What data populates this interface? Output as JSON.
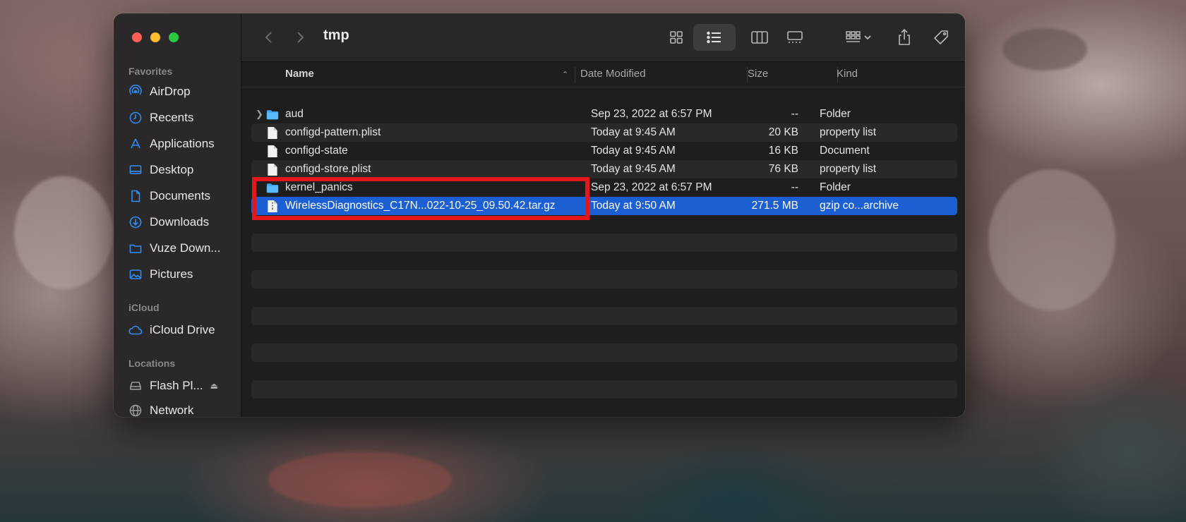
{
  "window": {
    "title": "tmp"
  },
  "sidebar": {
    "sections": {
      "favorites": "Favorites",
      "icloud": "iCloud",
      "locations": "Locations"
    },
    "favorites": [
      {
        "label": "AirDrop",
        "icon": "airdrop-icon"
      },
      {
        "label": "Recents",
        "icon": "clock-icon"
      },
      {
        "label": "Applications",
        "icon": "applications-icon"
      },
      {
        "label": "Desktop",
        "icon": "desktop-icon"
      },
      {
        "label": "Documents",
        "icon": "document-icon"
      },
      {
        "label": "Downloads",
        "icon": "download-icon"
      },
      {
        "label": "Vuze Down...",
        "icon": "folder-icon"
      },
      {
        "label": "Pictures",
        "icon": "photo-icon"
      }
    ],
    "icloud": [
      {
        "label": "iCloud Drive",
        "icon": "cloud-icon"
      }
    ],
    "locations": [
      {
        "label": "Flash Pl...",
        "icon": "drive-icon"
      },
      {
        "label": "Network",
        "icon": "globe-icon"
      }
    ]
  },
  "columns": {
    "name": "Name",
    "date": "Date Modified",
    "size": "Size",
    "kind": "Kind"
  },
  "files": [
    {
      "name": "aud",
      "date": "Sep 23, 2022 at 6:57 PM",
      "size": "--",
      "kind": "Folder",
      "type": "folder",
      "expandable": true
    },
    {
      "name": "configd-pattern.plist",
      "date": "Today at 9:45 AM",
      "size": "20 KB",
      "kind": "property list",
      "type": "file"
    },
    {
      "name": "configd-state",
      "date": "Today at 9:45 AM",
      "size": "16 KB",
      "kind": "Document",
      "type": "file"
    },
    {
      "name": "configd-store.plist",
      "date": "Today at 9:45 AM",
      "size": "76 KB",
      "kind": "property list",
      "type": "file"
    },
    {
      "name": "kernel_panics",
      "date": "Sep 23, 2022 at 6:57 PM",
      "size": "--",
      "kind": "Folder",
      "type": "folder"
    },
    {
      "name": "WirelessDiagnostics_C17N...022-10-25_09.50.42.tar.gz",
      "date": "Today at 9:50 AM",
      "size": "271.5 MB",
      "kind": "gzip co...archive",
      "type": "archive",
      "selected": true
    }
  ],
  "colors": {
    "selection": "#1b5fd3",
    "accent": "#2e8ef5",
    "annotation": "#e4171a"
  }
}
